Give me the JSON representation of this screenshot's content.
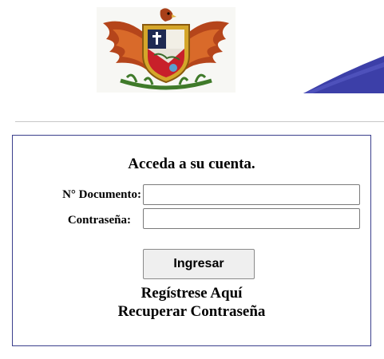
{
  "header": {
    "crest_icon": "coat-of-arms-eagle-crest",
    "swoosh_color": "#3c3fa8"
  },
  "login": {
    "title": "Acceda a su cuenta.",
    "document_label": "N° Documento:",
    "document_value": "",
    "password_label": "Contraseña:",
    "password_value": "",
    "submit_label": "Ingresar",
    "register_link": "Regístrese Aquí",
    "recover_link": "Recuperar Contraseña",
    "border_color": "#3b3f8c"
  }
}
